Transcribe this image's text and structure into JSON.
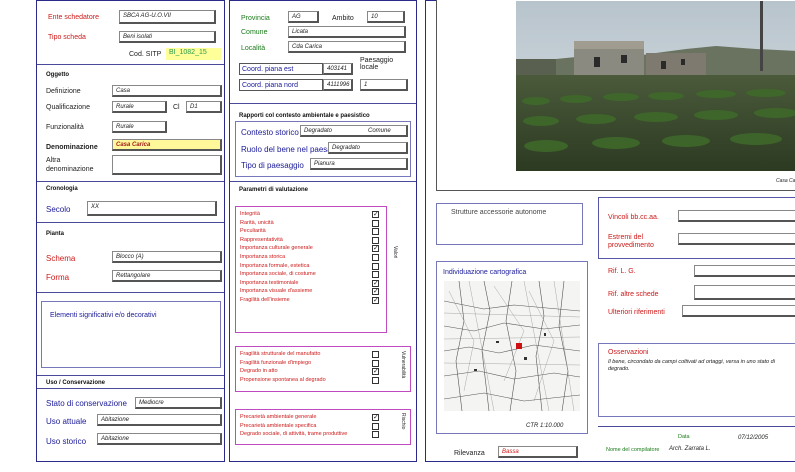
{
  "left": {
    "ente_label": "Ente schedatore",
    "ente_value": "SBCA AG-U.O.VII",
    "tipo_label": "Tipo scheda",
    "tipo_value": "Beni isolati",
    "cod_label": "Cod. SITP",
    "cod_value": "BI_1082_15",
    "oggetto_title": "Oggetto",
    "definizione_label": "Definizione",
    "definizione_value": "Casa",
    "qualificazione_label": "Qualificazione",
    "qualificazione_value": "Rurale",
    "cl_label": "Cl",
    "cl_value": "D1",
    "funzionalita_label": "Funzionalità",
    "funzionalita_value": "Rurale",
    "denominazione_label": "Denominazione",
    "denominazione_value": "Casa Carica",
    "altra_label_1": "Altra",
    "altra_label_2": "denominazione",
    "cronologia_title": "Cronologia",
    "secolo_label": "Secolo",
    "secolo_value": "XX",
    "pianta_title": "Pianta",
    "schema_label": "Schema",
    "schema_value": "Blocco (A)",
    "forma_label": "Forma",
    "forma_value": "Rettangolare",
    "elementi_label": "Elementi significativi e/o decorativi",
    "uso_title": "Uso / Conservazione",
    "stato_label": "Stato di conservazione",
    "stato_value": "Mediocre",
    "uso_attuale_label": "Uso attuale",
    "uso_attuale_value": "Abitazione",
    "uso_storico_label": "Uso storico",
    "uso_storico_value": "Abitazione"
  },
  "middle": {
    "provincia_label": "Provincia",
    "provincia_value": "AG",
    "ambito_label": "Ambito",
    "ambito_value": "10",
    "comune_label": "Comune",
    "comune_value": "Licata",
    "localita_label": "Località",
    "localita_value": "Cda Carica",
    "paesaggio_label_1": "Paesaggio",
    "paesaggio_label_2": "locale",
    "coord_est_label": "Coord. piana est",
    "coord_est_value": "403141",
    "coord_nord_label": "Coord. piana nord",
    "coord_nord_value": "4111996",
    "paesaggio_value": "1",
    "rapporti_title": "Rapporti col contesto ambientale e paesistico",
    "contesto_label": "Contesto storico",
    "contesto_value": "Degradato",
    "contesto_value2": "Comune",
    "ruolo_label": "Ruolo del bene nel paesaggio",
    "ruolo_value": "Degradato",
    "tipo_paesaggio_label": "Tipo di paesaggio",
    "tipo_paesaggio_value": "Pianura",
    "parametri_title": "Parametri di valutazione",
    "values_items": [
      "Integrità",
      "Rarità, unicità",
      "Peculiarità",
      "Rappresentatività",
      "Importanza culturale generale",
      "Importanza storica",
      "Importanza formale, estetica",
      "Importanza sociale, di costume",
      "Importanza testimoniale",
      "Importanza visuale d'assieme",
      "Fragilità dell'insieme"
    ],
    "values_checked": [
      true,
      false,
      false,
      false,
      true,
      false,
      false,
      false,
      true,
      true,
      true
    ],
    "values_vlabel": "Valori",
    "vuln_items": [
      "Fragilità strutturale del manufatto",
      "Fragilità funzionale d'impiego",
      "Degrado in atto",
      "Propensione spontanea al degrado"
    ],
    "vuln_checked": [
      false,
      false,
      true,
      false
    ],
    "vuln_vlabel": "Vulnerabilità",
    "risk_items": [
      "Precarietà ambientale generale",
      "Precarietà ambientale specifica",
      "Degrado sociale, di attività, trame produttive"
    ],
    "risk_checked": [
      true,
      false,
      false
    ],
    "risk_vlabel": "Rischio"
  },
  "right": {
    "photo_caption": "Casa Carica",
    "strutture_label": "Strutture accessorie autonome",
    "vincoli_label": "Vincoli bb.cc.aa.",
    "estremi_label_1": "Estremi del",
    "estremi_label_2": "provvedimento",
    "individuazione_label": "Individuazione cartografica",
    "ctr_label": "CTR 1:10.000",
    "rif_lg_label": "Rif. L. G.",
    "rif_altre_label": "Rif. altre schede",
    "ulteriori_label": "Ulteriori riferimenti",
    "osservazioni_label": "Osservazioni",
    "osservazioni_text": "Il bene, circondato da campi coltivati ad ortaggi, versa in uno stato di degrado.",
    "rilevanza_label": "Rilevanza",
    "rilevanza_value": "Bassa",
    "compilatore_label": "Nome del compilatore",
    "compilatore_value": "Arch. Zarrata L.",
    "data_label": "Data",
    "data_value": "07/12/2005"
  }
}
